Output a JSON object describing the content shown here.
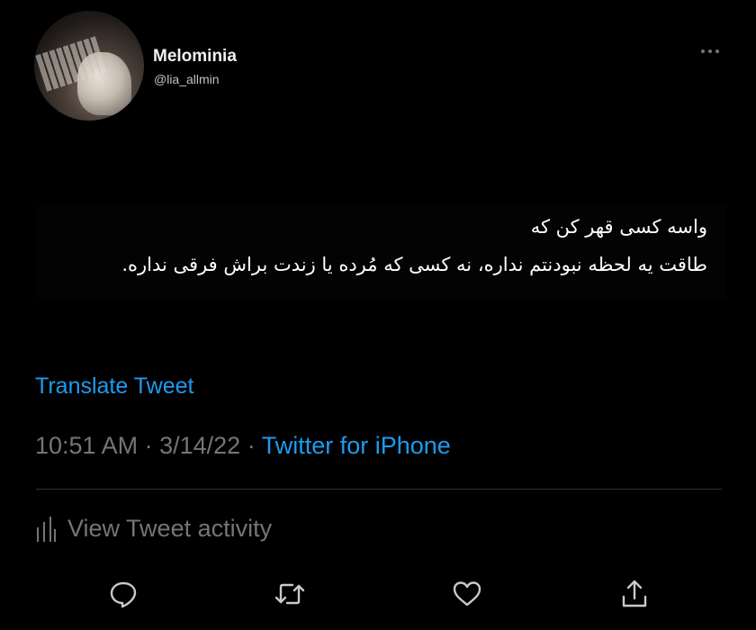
{
  "profile": {
    "display_name": "Melominia",
    "handle": "@lia_allmin"
  },
  "tweet": {
    "lines": [
      "واسه کسی قهر کن که",
      "طاقت یه لحظه نبودنتم نداره، نه کسی که مُرده یا زندت براش فرقی نداره."
    ]
  },
  "translate_label": "Translate Tweet",
  "meta": {
    "time": "10:51 AM",
    "date": "3/14/22",
    "separator": "·",
    "source": "Twitter for iPhone"
  },
  "activity_label": "View Tweet activity",
  "actions": {
    "reply_icon": "reply-icon",
    "retweet_icon": "retweet-icon",
    "like_icon": "like-icon",
    "share_icon": "share-icon"
  },
  "colors": {
    "background": "#000000",
    "link_blue": "#1d9bf0",
    "muted_gray": "#71767b",
    "icon_gray": "#c7c9cb"
  }
}
